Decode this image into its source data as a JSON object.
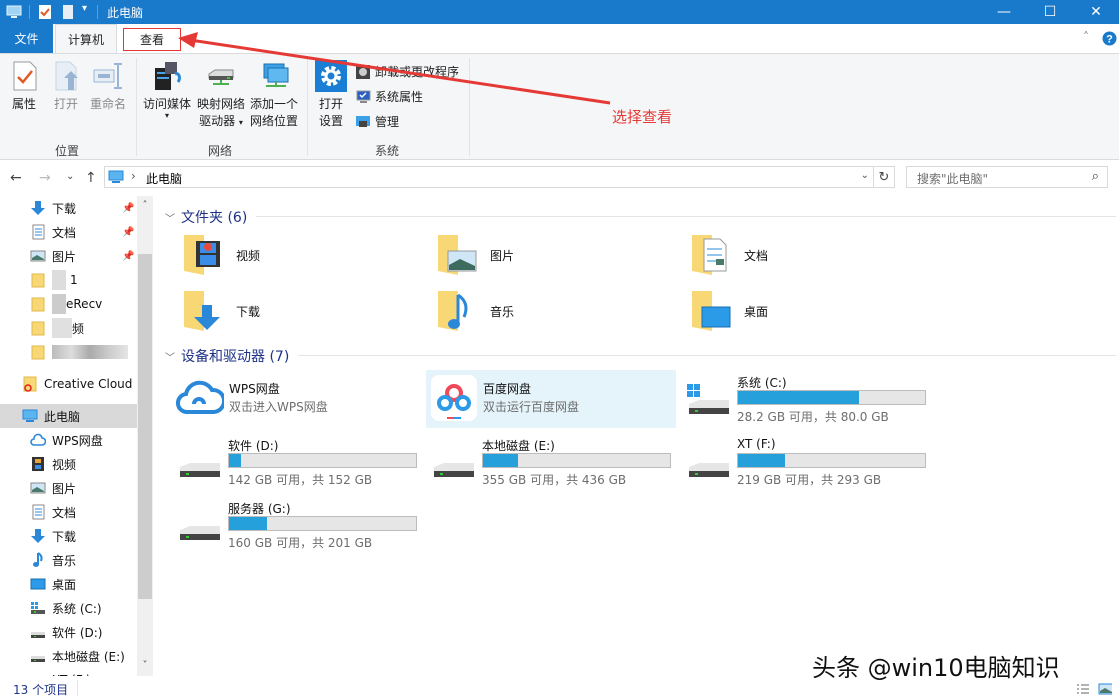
{
  "window": {
    "title": "此电脑",
    "controls": {
      "minimize": "—",
      "maximize": "☐",
      "close": "✕"
    }
  },
  "tabs": {
    "file": "文件",
    "computer": "计算机",
    "view": "查看"
  },
  "ribbon": {
    "groups": {
      "location": {
        "label": "位置",
        "buttons": {
          "properties": "属性",
          "open": "打开",
          "rename": "重命名"
        }
      },
      "network": {
        "label": "网络",
        "buttons": {
          "access_media": "访问媒体",
          "map_drive_1": "映射网络",
          "map_drive_2": "驱动器",
          "add_location_1": "添加一个",
          "add_location_2": "网络位置"
        }
      },
      "system": {
        "label": "系统",
        "buttons": {
          "open_settings_1": "打开",
          "open_settings_2": "设置",
          "uninstall": "卸载或更改程序",
          "system_properties": "系统属性",
          "manage": "管理"
        }
      }
    }
  },
  "annotation": {
    "text": "选择查看",
    "color": "#e53935"
  },
  "navigation": {
    "back": "←",
    "forward": "→",
    "recent": "⌄",
    "up": "↑",
    "breadcrumb_sep": "›",
    "address": "此电脑",
    "refresh": "↻",
    "search_placeholder": "搜索\"此电脑\"",
    "search_icon": "⌕"
  },
  "sidebar": {
    "quick_access": [
      {
        "label": "下载",
        "icon": "download-icon",
        "pinned": true
      },
      {
        "label": "文档",
        "icon": "document-icon",
        "pinned": true
      },
      {
        "label": "图片",
        "icon": "picture-icon",
        "pinned": true
      },
      {
        "label": "1",
        "icon": "folder-icon",
        "pinned": false
      },
      {
        "label": "eRecv",
        "icon": "folder-icon",
        "pinned": false
      },
      {
        "label": "频",
        "icon": "folder-icon",
        "pinned": false
      },
      {
        "label": "",
        "icon": "folder-icon",
        "pinned": false
      }
    ],
    "creative_cloud": "Creative Cloud F",
    "this_pc": "此电脑",
    "pc_items": [
      {
        "label": "WPS网盘",
        "icon": "cloud-icon"
      },
      {
        "label": "视频",
        "icon": "video-icon"
      },
      {
        "label": "图片",
        "icon": "picture-icon"
      },
      {
        "label": "文档",
        "icon": "document-icon"
      },
      {
        "label": "下载",
        "icon": "download-icon"
      },
      {
        "label": "音乐",
        "icon": "music-icon"
      },
      {
        "label": "桌面",
        "icon": "desktop-icon"
      },
      {
        "label": "系统 (C:)",
        "icon": "windows-drive-icon"
      },
      {
        "label": "软件 (D:)",
        "icon": "drive-icon"
      },
      {
        "label": "本地磁盘 (E:)",
        "icon": "drive-icon"
      },
      {
        "label": "XT (F:)",
        "icon": "drive-icon"
      }
    ],
    "scroll_up": "˄",
    "scroll_down": "˅"
  },
  "content": {
    "folders_header": "文件夹 (6)",
    "folders": [
      {
        "name": "视频",
        "icon": "video-folder-icon"
      },
      {
        "name": "图片",
        "icon": "picture-folder-icon"
      },
      {
        "name": "文档",
        "icon": "document-folder-icon"
      },
      {
        "name": "下载",
        "icon": "download-folder-icon"
      },
      {
        "name": "音乐",
        "icon": "music-folder-icon"
      },
      {
        "name": "桌面",
        "icon": "desktop-folder-icon"
      }
    ],
    "devices_header": "设备和驱动器 (7)",
    "network_drives": [
      {
        "name": "WPS网盘",
        "sub": "双击进入WPS网盘"
      },
      {
        "name": "百度网盘",
        "sub": "双击运行百度网盘"
      }
    ],
    "drives": [
      {
        "name": "系统 (C:)",
        "info": "28.2 GB 可用，共 80.0 GB",
        "used_fraction": 0.6475
      },
      {
        "name": "软件 (D:)",
        "info": "142 GB 可用，共 152 GB",
        "used_fraction": 0.0658
      },
      {
        "name": "本地磁盘 (E:)",
        "info": "355 GB 可用，共 436 GB",
        "used_fraction": 0.1858
      },
      {
        "name": "XT (F:)",
        "info": "219 GB 可用，共 293 GB",
        "used_fraction": 0.2526
      },
      {
        "name": "服务器 (G:)",
        "info": "160 GB 可用，共 201 GB",
        "used_fraction": 0.204
      }
    ]
  },
  "status": {
    "items": "13 个项目"
  },
  "watermark": "头条 @win10电脑知识",
  "colors": {
    "accent": "#1979ca",
    "drive_fill": "#26a0da",
    "selection": "#e5f3fb"
  }
}
